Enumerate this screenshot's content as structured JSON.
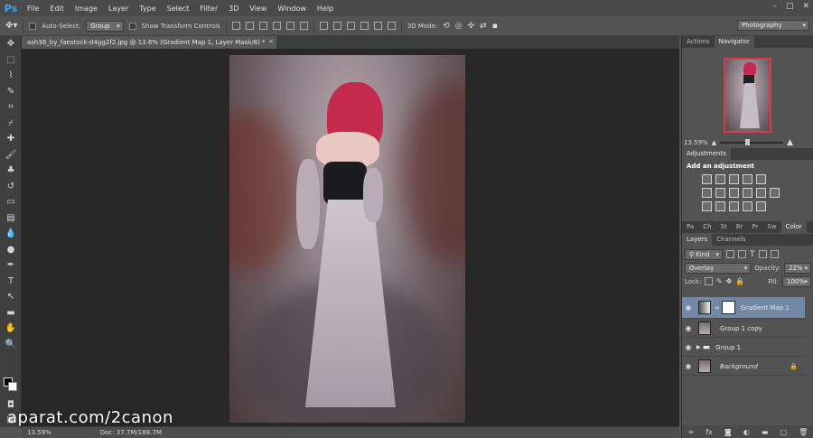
{
  "app": {
    "logo": "Ps"
  },
  "menu": [
    "File",
    "Edit",
    "Image",
    "Layer",
    "Type",
    "Select",
    "Filter",
    "3D",
    "View",
    "Window",
    "Help"
  ],
  "window_controls": {
    "minimize": "–",
    "restore": "□",
    "close": "✕"
  },
  "options_bar": {
    "auto_select_label": "Auto-Select:",
    "auto_select_value": "Group",
    "show_transform_label": "Show Transform Controls",
    "mode_3d_label": "3D Mode:",
    "workspace": "Photography"
  },
  "document": {
    "tab_title": "ash36_by_faestock-d4gg2f2.jpg @ 13.6% (Gradient Map 1, Layer Mask/8) *",
    "close": "×"
  },
  "status": {
    "zoom": "13.59%",
    "doc": "Doc: 37.7M/188.7M"
  },
  "watermark": "aparat.com/2canon",
  "navigator": {
    "tabs": [
      "Actions",
      "Navigator"
    ],
    "zoom": "13.59%"
  },
  "adjustments": {
    "tab": "Adjustments",
    "title": "Add an adjustment"
  },
  "mini_panel": {
    "tabs": [
      "Pa",
      "Ch",
      "St",
      "Br",
      "Pr",
      "Sw",
      "Color"
    ]
  },
  "layers": {
    "tabs": [
      "Layers",
      "Channels"
    ],
    "filter": "Kind",
    "blend_mode": "Overlay",
    "opacity_label": "Opacity:",
    "opacity": "22%",
    "lock_label": "Lock:",
    "fill_label": "Fill:",
    "fill": "100%",
    "items": [
      {
        "name": "Gradient Map 1"
      },
      {
        "name": "Group 1 copy"
      },
      {
        "name": "Group 1"
      },
      {
        "name": "Background"
      }
    ],
    "footer_fx": "fx"
  }
}
